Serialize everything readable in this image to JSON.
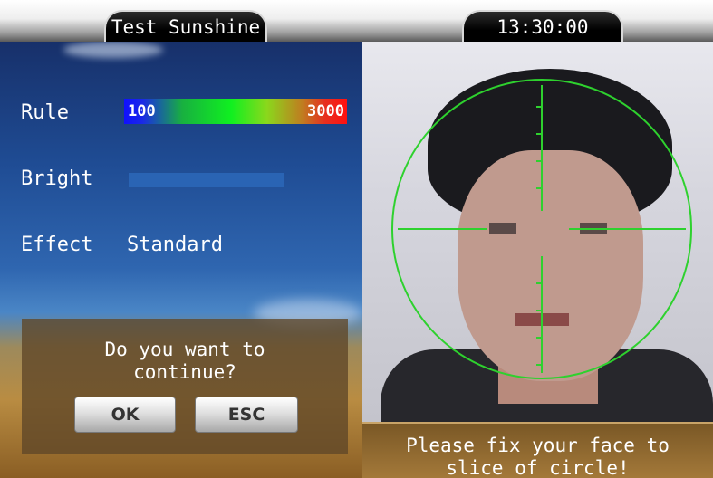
{
  "header": {
    "title": "Test Sunshine",
    "time": "13:30:00"
  },
  "settings": {
    "rule_label": "Rule",
    "rule_min": "100",
    "rule_max": "3000",
    "bright_label": "Bright",
    "effect_label": "Effect",
    "effect_value": "Standard"
  },
  "dialog": {
    "message_line1": "Do you want to",
    "message_line2": "continue?",
    "ok_label": "OK",
    "esc_label": "ESC"
  },
  "camera": {
    "hint_line1": "Please fix your face to",
    "hint_line2": "slice of circle!",
    "target_color": "#2ed12e"
  }
}
